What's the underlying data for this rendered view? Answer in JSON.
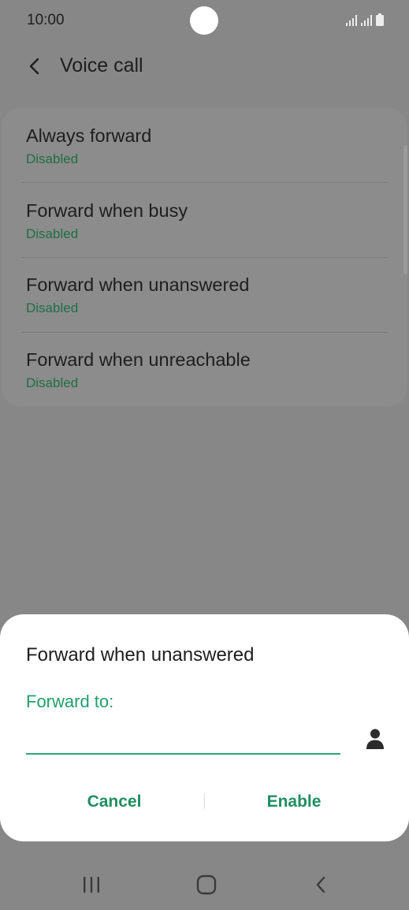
{
  "status_bar": {
    "time": "10:00"
  },
  "app_bar": {
    "back_icon": "chevron-left-icon",
    "title": "Voice call"
  },
  "forwarding_options": [
    {
      "title": "Always forward",
      "status": "Disabled"
    },
    {
      "title": "Forward when busy",
      "status": "Disabled"
    },
    {
      "title": "Forward when unanswered",
      "status": "Disabled"
    },
    {
      "title": "Forward when unreachable",
      "status": "Disabled"
    }
  ],
  "dialog": {
    "title": "Forward when unanswered",
    "field_label": "Forward to:",
    "field_value": "",
    "contact_icon": "person-icon",
    "cancel_label": "Cancel",
    "enable_label": "Enable"
  },
  "nav_bar": {
    "recents_icon": "recents-icon",
    "home_icon": "home-icon",
    "back_icon": "back-icon"
  },
  "colors": {
    "accent": "#1fa06a",
    "status_text": "#1f6e47",
    "scrim_background": "#878787",
    "dialog_background": "#ffffff"
  }
}
